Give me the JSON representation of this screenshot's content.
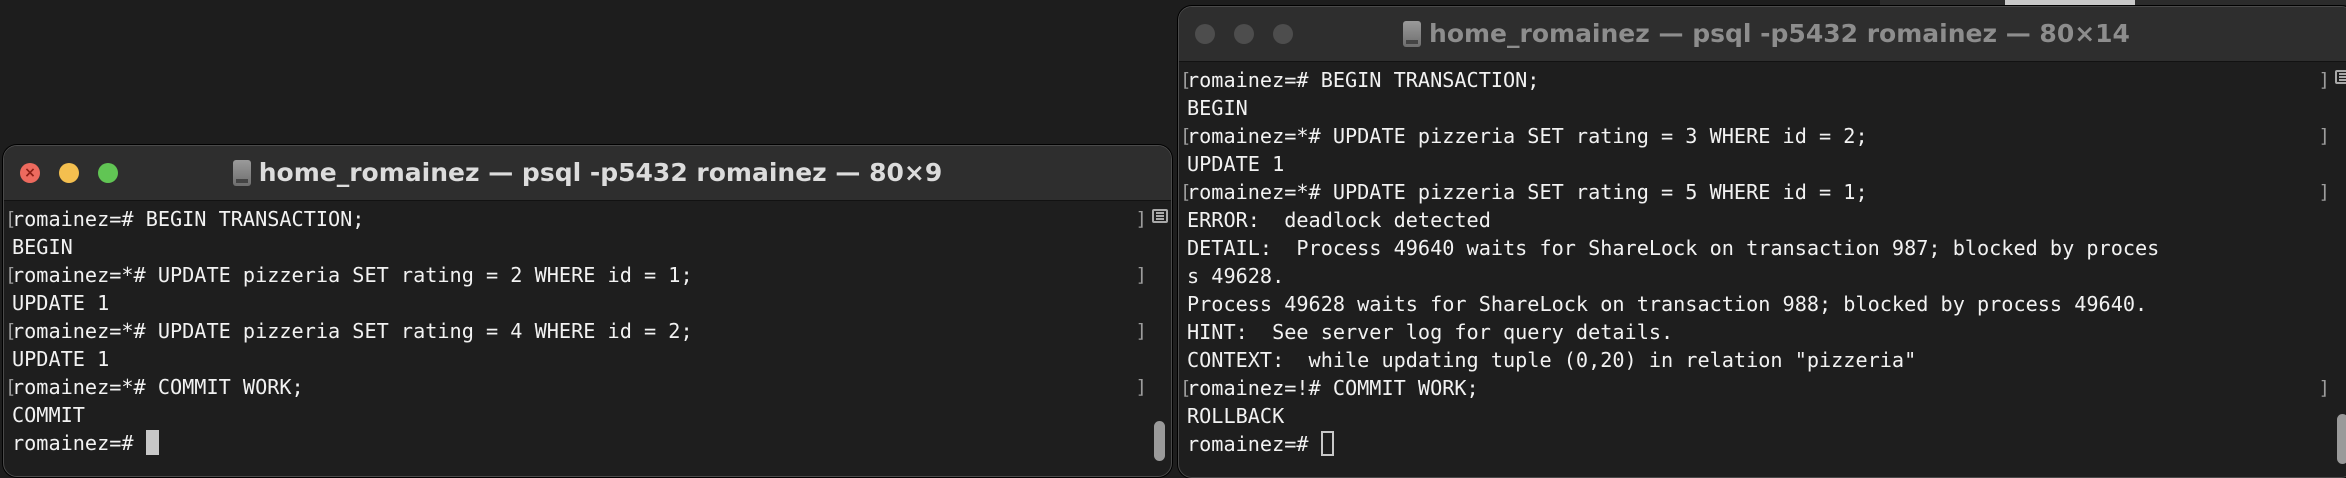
{
  "left_window": {
    "title": "home_romainez — psql -p5432 romainez — 80×9",
    "state": "active",
    "lines": [
      {
        "text": "romainez=# BEGIN TRANSACTION;",
        "marked": true
      },
      {
        "text": "BEGIN",
        "marked": false
      },
      {
        "text": "romainez=*# UPDATE pizzeria SET rating = 2 WHERE id = 1;",
        "marked": true
      },
      {
        "text": "UPDATE 1",
        "marked": false
      },
      {
        "text": "romainez=*# UPDATE pizzeria SET rating = 4 WHERE id = 2;",
        "marked": true
      },
      {
        "text": "UPDATE 1",
        "marked": false
      },
      {
        "text": "romainez=*# COMMIT WORK;",
        "marked": true
      },
      {
        "text": "COMMIT",
        "marked": false
      }
    ],
    "prompt": "romainez=# ",
    "cursor_style": "solid"
  },
  "right_window": {
    "title": "home_romainez — psql -p5432 romainez — 80×14",
    "state": "inactive",
    "lines": [
      {
        "text": "romainez=# BEGIN TRANSACTION;",
        "marked": true
      },
      {
        "text": "BEGIN",
        "marked": false
      },
      {
        "text": "romainez=*# UPDATE pizzeria SET rating = 3 WHERE id = 2;",
        "marked": true
      },
      {
        "text": "UPDATE 1",
        "marked": false
      },
      {
        "text": "romainez=*# UPDATE pizzeria SET rating = 5 WHERE id = 1;",
        "marked": true
      },
      {
        "text": "ERROR:  deadlock detected",
        "marked": false
      },
      {
        "text": "DETAIL:  Process 49640 waits for ShareLock on transaction 987; blocked by proces",
        "marked": false
      },
      {
        "text": "s 49628.",
        "marked": false
      },
      {
        "text": "Process 49628 waits for ShareLock on transaction 988; blocked by process 49640.",
        "marked": false
      },
      {
        "text": "HINT:  See server log for query details.",
        "marked": false
      },
      {
        "text": "CONTEXT:  while updating tuple (0,20) in relation \"pizzeria\"",
        "marked": false
      },
      {
        "text": "romainez=!# COMMIT WORK;",
        "marked": true
      },
      {
        "text": "ROLLBACK",
        "marked": false
      }
    ],
    "prompt": "romainez=# ",
    "cursor_style": "hollow"
  },
  "icons": {
    "window_icon": "terminal-disk-icon",
    "split_toggle": "split-view-icon",
    "close": "close-icon",
    "minimize": "minimize-icon",
    "maximize": "maximize-icon"
  }
}
